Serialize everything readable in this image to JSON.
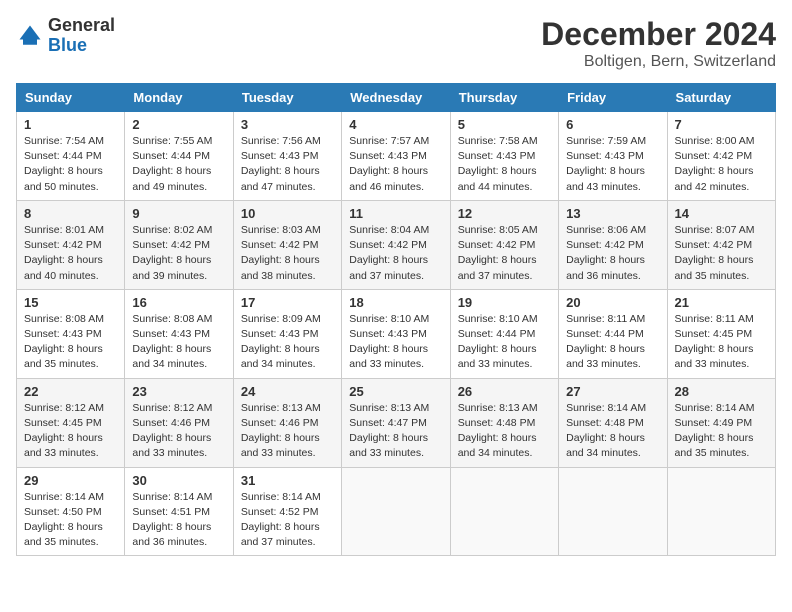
{
  "logo": {
    "general": "General",
    "blue": "Blue"
  },
  "title": "December 2024",
  "subtitle": "Boltigen, Bern, Switzerland",
  "days_of_week": [
    "Sunday",
    "Monday",
    "Tuesday",
    "Wednesday",
    "Thursday",
    "Friday",
    "Saturday"
  ],
  "weeks": [
    [
      {
        "day": "1",
        "sunrise": "7:54 AM",
        "sunset": "4:44 PM",
        "daylight": "8 hours and 50 minutes."
      },
      {
        "day": "2",
        "sunrise": "7:55 AM",
        "sunset": "4:44 PM",
        "daylight": "8 hours and 49 minutes."
      },
      {
        "day": "3",
        "sunrise": "7:56 AM",
        "sunset": "4:43 PM",
        "daylight": "8 hours and 47 minutes."
      },
      {
        "day": "4",
        "sunrise": "7:57 AM",
        "sunset": "4:43 PM",
        "daylight": "8 hours and 46 minutes."
      },
      {
        "day": "5",
        "sunrise": "7:58 AM",
        "sunset": "4:43 PM",
        "daylight": "8 hours and 44 minutes."
      },
      {
        "day": "6",
        "sunrise": "7:59 AM",
        "sunset": "4:43 PM",
        "daylight": "8 hours and 43 minutes."
      },
      {
        "day": "7",
        "sunrise": "8:00 AM",
        "sunset": "4:42 PM",
        "daylight": "8 hours and 42 minutes."
      }
    ],
    [
      {
        "day": "8",
        "sunrise": "8:01 AM",
        "sunset": "4:42 PM",
        "daylight": "8 hours and 40 minutes."
      },
      {
        "day": "9",
        "sunrise": "8:02 AM",
        "sunset": "4:42 PM",
        "daylight": "8 hours and 39 minutes."
      },
      {
        "day": "10",
        "sunrise": "8:03 AM",
        "sunset": "4:42 PM",
        "daylight": "8 hours and 38 minutes."
      },
      {
        "day": "11",
        "sunrise": "8:04 AM",
        "sunset": "4:42 PM",
        "daylight": "8 hours and 37 minutes."
      },
      {
        "day": "12",
        "sunrise": "8:05 AM",
        "sunset": "4:42 PM",
        "daylight": "8 hours and 37 minutes."
      },
      {
        "day": "13",
        "sunrise": "8:06 AM",
        "sunset": "4:42 PM",
        "daylight": "8 hours and 36 minutes."
      },
      {
        "day": "14",
        "sunrise": "8:07 AM",
        "sunset": "4:42 PM",
        "daylight": "8 hours and 35 minutes."
      }
    ],
    [
      {
        "day": "15",
        "sunrise": "8:08 AM",
        "sunset": "4:43 PM",
        "daylight": "8 hours and 35 minutes."
      },
      {
        "day": "16",
        "sunrise": "8:08 AM",
        "sunset": "4:43 PM",
        "daylight": "8 hours and 34 minutes."
      },
      {
        "day": "17",
        "sunrise": "8:09 AM",
        "sunset": "4:43 PM",
        "daylight": "8 hours and 34 minutes."
      },
      {
        "day": "18",
        "sunrise": "8:10 AM",
        "sunset": "4:43 PM",
        "daylight": "8 hours and 33 minutes."
      },
      {
        "day": "19",
        "sunrise": "8:10 AM",
        "sunset": "4:44 PM",
        "daylight": "8 hours and 33 minutes."
      },
      {
        "day": "20",
        "sunrise": "8:11 AM",
        "sunset": "4:44 PM",
        "daylight": "8 hours and 33 minutes."
      },
      {
        "day": "21",
        "sunrise": "8:11 AM",
        "sunset": "4:45 PM",
        "daylight": "8 hours and 33 minutes."
      }
    ],
    [
      {
        "day": "22",
        "sunrise": "8:12 AM",
        "sunset": "4:45 PM",
        "daylight": "8 hours and 33 minutes."
      },
      {
        "day": "23",
        "sunrise": "8:12 AM",
        "sunset": "4:46 PM",
        "daylight": "8 hours and 33 minutes."
      },
      {
        "day": "24",
        "sunrise": "8:13 AM",
        "sunset": "4:46 PM",
        "daylight": "8 hours and 33 minutes."
      },
      {
        "day": "25",
        "sunrise": "8:13 AM",
        "sunset": "4:47 PM",
        "daylight": "8 hours and 33 minutes."
      },
      {
        "day": "26",
        "sunrise": "8:13 AM",
        "sunset": "4:48 PM",
        "daylight": "8 hours and 34 minutes."
      },
      {
        "day": "27",
        "sunrise": "8:14 AM",
        "sunset": "4:48 PM",
        "daylight": "8 hours and 34 minutes."
      },
      {
        "day": "28",
        "sunrise": "8:14 AM",
        "sunset": "4:49 PM",
        "daylight": "8 hours and 35 minutes."
      }
    ],
    [
      {
        "day": "29",
        "sunrise": "8:14 AM",
        "sunset": "4:50 PM",
        "daylight": "8 hours and 35 minutes."
      },
      {
        "day": "30",
        "sunrise": "8:14 AM",
        "sunset": "4:51 PM",
        "daylight": "8 hours and 36 minutes."
      },
      {
        "day": "31",
        "sunrise": "8:14 AM",
        "sunset": "4:52 PM",
        "daylight": "8 hours and 37 minutes."
      },
      null,
      null,
      null,
      null
    ]
  ],
  "labels": {
    "sunrise": "Sunrise:",
    "sunset": "Sunset:",
    "daylight": "Daylight:"
  }
}
